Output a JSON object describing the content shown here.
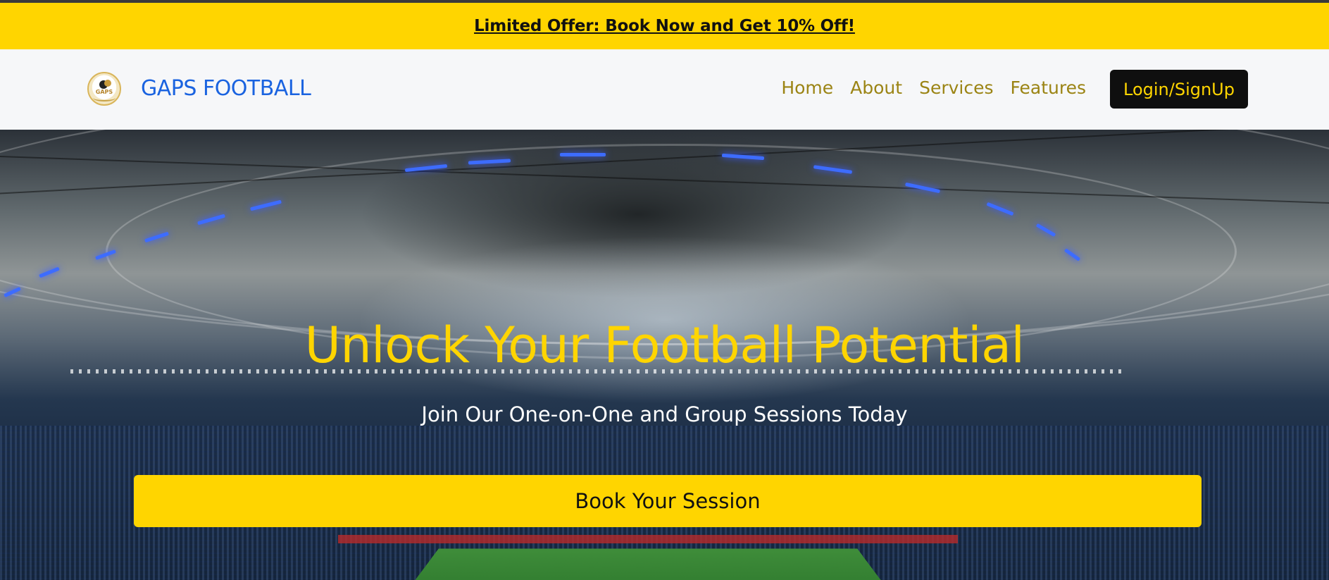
{
  "promo": {
    "text": "Limited Offer: Book Now and Get 10% Off!"
  },
  "navbar": {
    "brand": "GAPS FOOTBALL",
    "logo_text": "GAPS",
    "links": [
      "Home",
      "About",
      "Services",
      "Features"
    ],
    "login_label": "Login/SignUp"
  },
  "hero": {
    "title": "Unlock Your Football Potential",
    "subtitle": "Join Our One-on-One and Group Sessions Today",
    "cta_label": "Book Your Session"
  },
  "colors": {
    "accent": "#ffd500",
    "brand_blue": "#1a63e0",
    "nav_link": "#9b8414",
    "button_dark": "#0f0f0f",
    "navbar_bg": "#f6f7f9"
  },
  "icons": {
    "logo": "gaps-football-logo-icon"
  }
}
